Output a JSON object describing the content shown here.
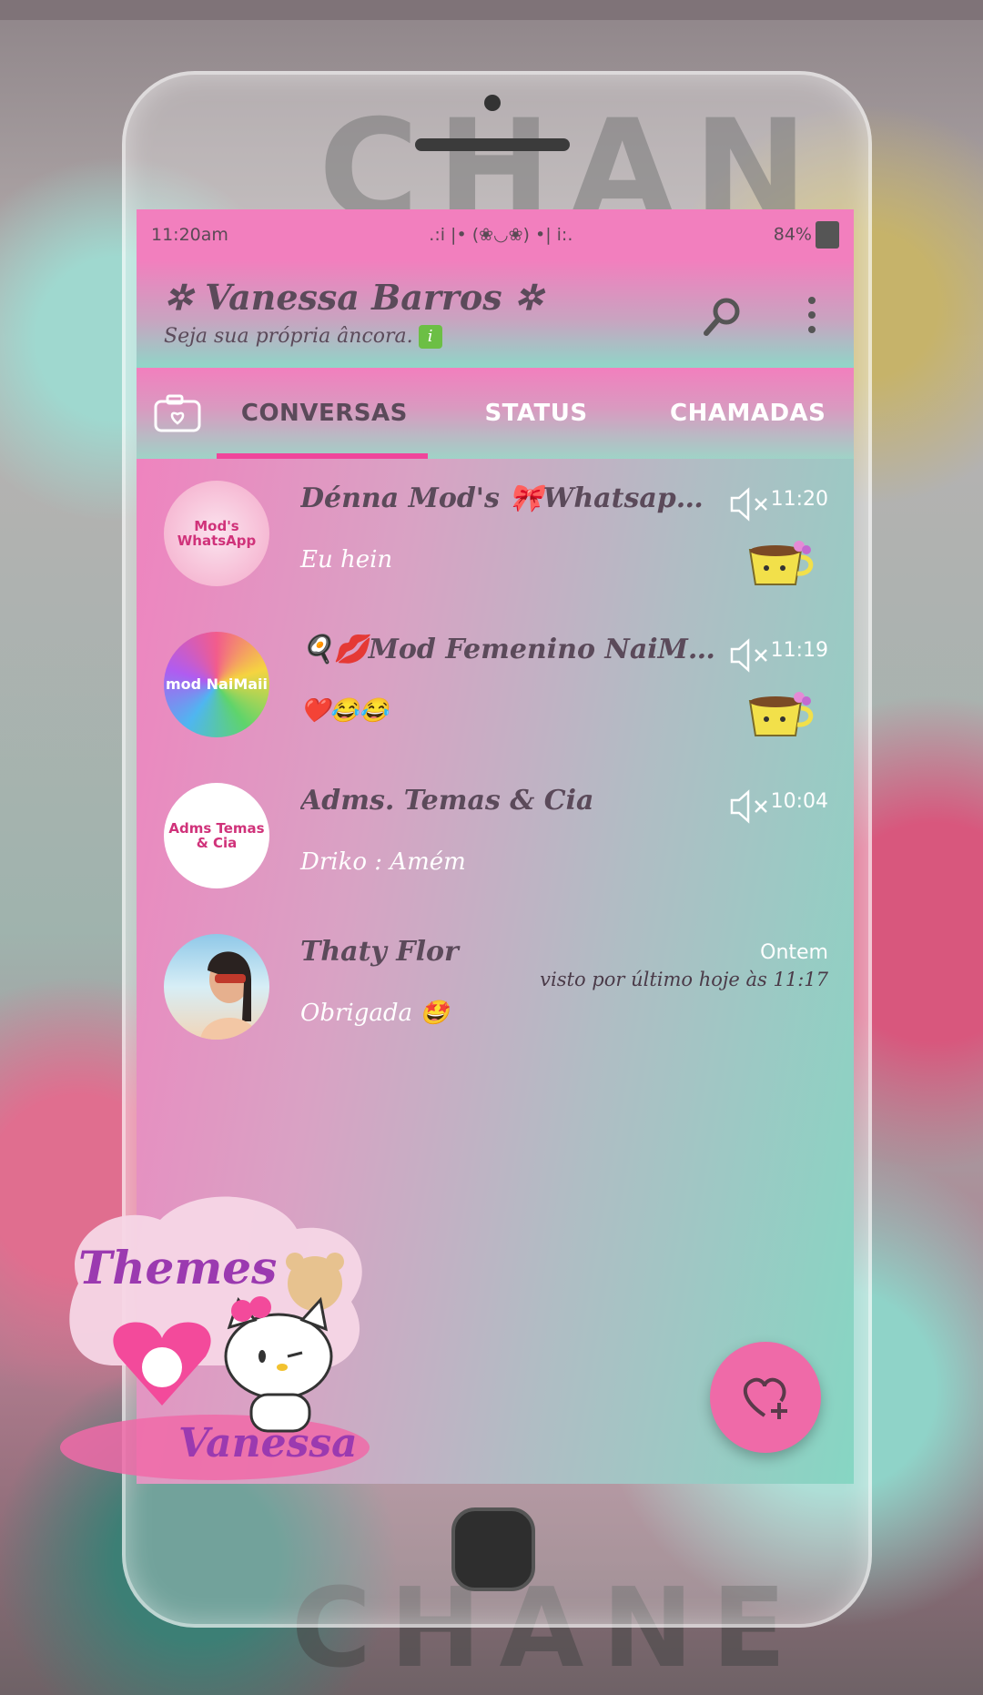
{
  "background": {
    "words": [
      "CHAN",
      "CHANE"
    ]
  },
  "statusbar": {
    "time": "11:20am",
    "center": ".:i |• (❀◡❀) •| i:.",
    "battery": "84%"
  },
  "header": {
    "title": "✲ Vanessa Barros ✲",
    "subtitle": "Seja sua própria âncora."
  },
  "tabs": [
    {
      "label": "CONVERSAS",
      "active": true
    },
    {
      "label": "STATUS",
      "active": false
    },
    {
      "label": "CHAMADAS",
      "active": false
    }
  ],
  "chats": [
    {
      "name": "Dénna Mod's 🎀Whatsapp Femin...",
      "message": "Eu hein",
      "time": "11:20",
      "muted": true,
      "avatar_text": "Mod's WhatsApp"
    },
    {
      "name": "🍳💋Mod Femenino NaiMaii💋🍳",
      "message": "❤️😂😂",
      "time": "11:19",
      "muted": true,
      "avatar_text": "mod NaiMaii"
    },
    {
      "name": "Adms. Temas & Cia",
      "message": "Driko : Amém",
      "time": "10:04",
      "muted": true,
      "avatar_text": "Adms Temas & Cia"
    },
    {
      "name": "Thaty Flor",
      "message": "Obrigada 🤩",
      "time": "Ontem",
      "status": "visto por último hoje às 11:17",
      "muted": false
    }
  ],
  "sticker": {
    "top_text": "Themes",
    "bottom_text": "Vanessa"
  },
  "colors": {
    "pink": "#f27fbe",
    "mint": "#86d6c3",
    "accent": "#f0459b",
    "text_dark": "#5b4a5a"
  }
}
